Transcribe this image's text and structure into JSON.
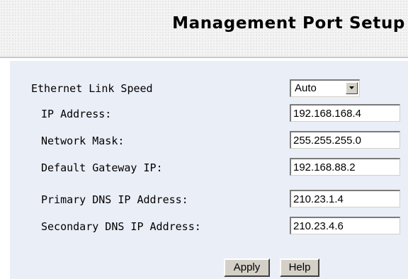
{
  "header": {
    "title": "Management Port Setup"
  },
  "form": {
    "ethernet_link_speed": {
      "label": "Ethernet Link Speed",
      "value": "Auto"
    },
    "ip_address": {
      "label": "IP Address:",
      "value": "192.168.168.4"
    },
    "network_mask": {
      "label": "Network Mask:",
      "value": "255.255.255.0"
    },
    "default_gateway": {
      "label": "Default Gateway IP:",
      "value": "192.168.88.2"
    },
    "primary_dns": {
      "label": "Primary DNS IP Address:",
      "value": "210.23.1.4"
    },
    "secondary_dns": {
      "label": "Secondary DNS IP Address:",
      "value": "210.23.4.6"
    }
  },
  "buttons": {
    "apply_label": "Apply",
    "help_label": "Help"
  },
  "colors": {
    "panel_background": "#eaeef7",
    "button_face": "#d4d0c8"
  }
}
